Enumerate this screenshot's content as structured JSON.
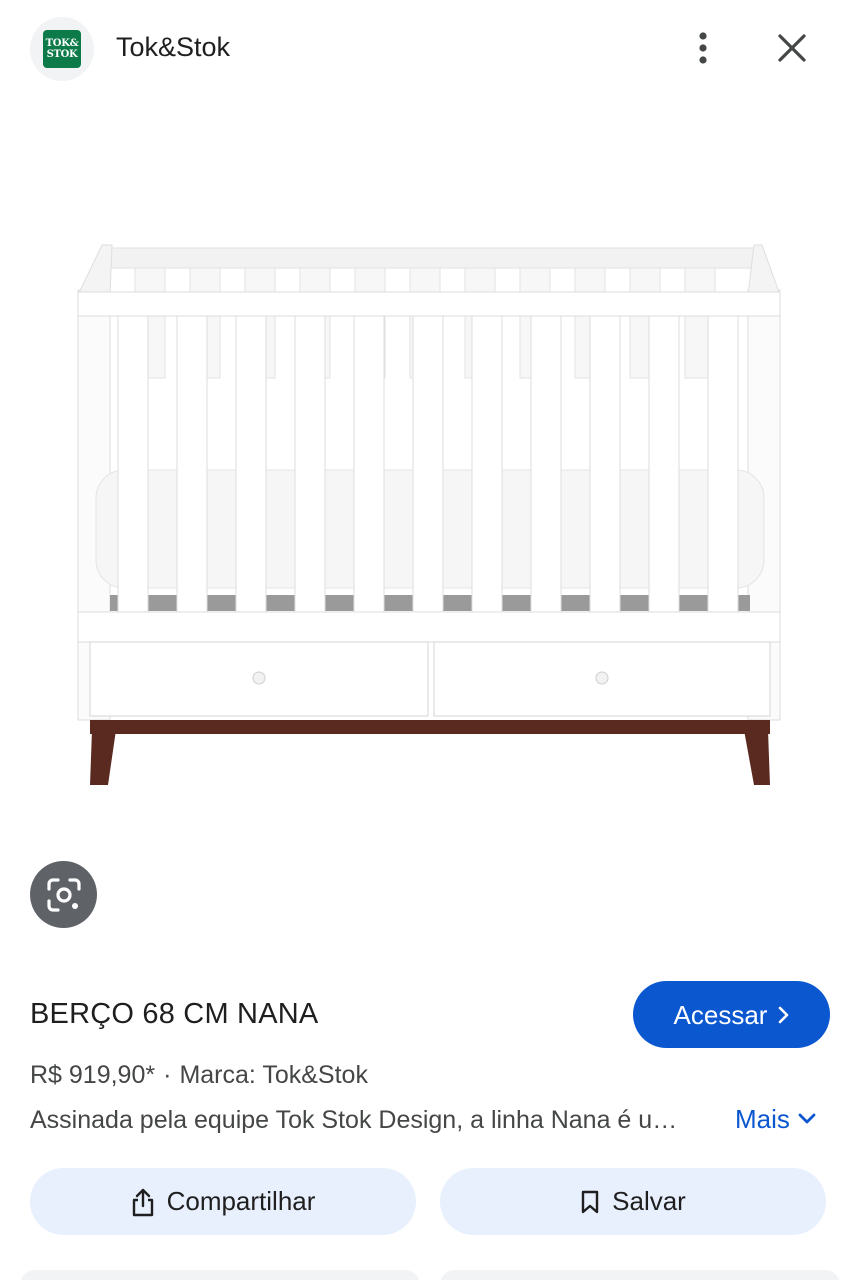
{
  "header": {
    "logo_text_line1": "TOK&",
    "logo_text_line2": "STOK",
    "site_name": "Tok&Stok",
    "more_icon": "more-vertical-icon",
    "close_icon": "close-icon"
  },
  "product": {
    "title": "BERÇO 68 CM NANA",
    "price": "R$ 919,90*",
    "separator": "·",
    "brand": "Marca: Tok&Stok",
    "description": "Assinada pela equipe Tok Stok Design, a linha Nana é uma linha completa para o quarto do bebê",
    "more_label": "Mais",
    "visit_label": "Acessar"
  },
  "actions": {
    "share_label": "Compartilhar",
    "save_label": "Salvar"
  },
  "colors": {
    "accent": "#0b57d0",
    "chip_bg": "#e8f0fe",
    "brand_green": "#0d7a4a",
    "crib_legs": "#5a2a20"
  }
}
